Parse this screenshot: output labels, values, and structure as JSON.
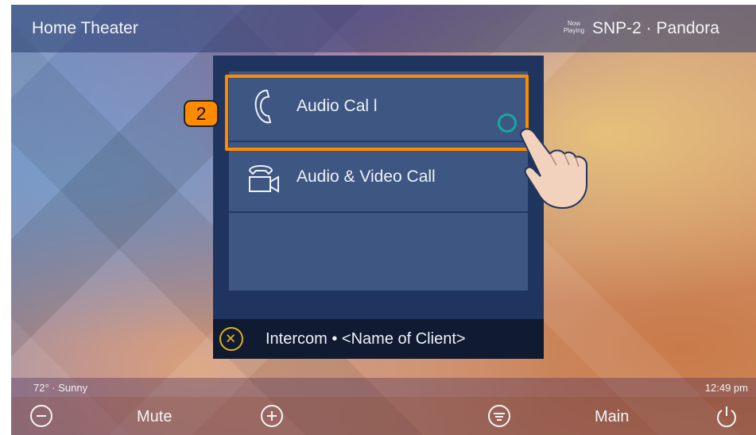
{
  "header": {
    "room_title": "Home Theater",
    "now_playing_line1": "Now",
    "now_playing_line2": "Playing",
    "source": "SNP-2 · Pandora"
  },
  "modal": {
    "options": [
      {
        "label": "Audio Cal l",
        "icon": "phone-handset-icon"
      },
      {
        "label": "Audio & Video Call",
        "icon": "video-phone-icon"
      },
      {
        "label": "",
        "icon": ""
      }
    ],
    "footer_label": "Intercom • <Name of Client>",
    "close_icon": "close-circle-icon"
  },
  "annotation": {
    "step_number": "2",
    "highlight_color": "#ff8a00"
  },
  "status": {
    "weather": "72° · Sunny",
    "time": "12:49 pm"
  },
  "bottom_bar": {
    "mute_label": "Mute",
    "main_label": "Main",
    "icons": [
      "volume-down-icon",
      "volume-up-icon",
      "menu-circle-icon",
      "power-icon"
    ]
  },
  "colors": {
    "modal_bg": "#1f3560",
    "option_bg": "#3d5682",
    "accent_teal": "#1aa6a0",
    "close_yellow": "#e0b020"
  }
}
